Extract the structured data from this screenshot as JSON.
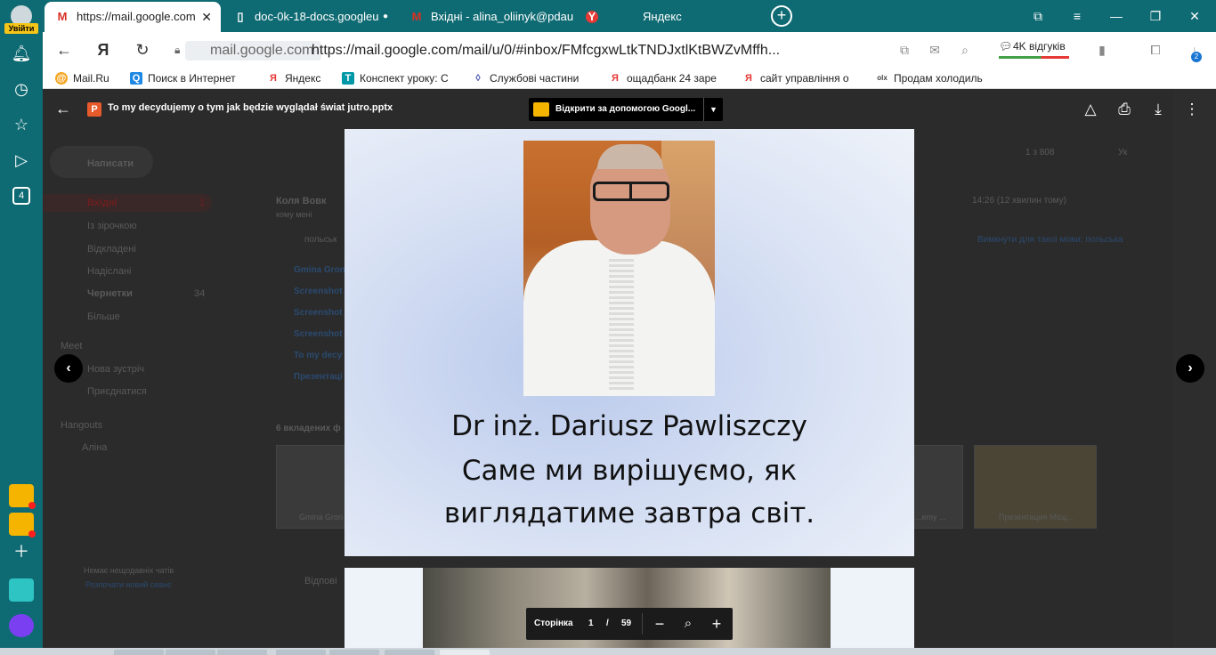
{
  "sidebar": {
    "login_label": "Увійти",
    "tab_count": "4"
  },
  "tabs": [
    {
      "label": "https://mail.google.com",
      "icon": "M",
      "color": "#d93025"
    },
    {
      "label": "doc-0k-18-docs.googleu",
      "icon": "▯",
      "color": "#ffffff"
    },
    {
      "label": "Вхідні - alina_oliinyk@pdau",
      "icon": "M",
      "color": "#d93025"
    },
    {
      "label": "Яндекс",
      "icon": "Y",
      "color": "#ffffff"
    }
  ],
  "address": {
    "domain": "mail.google.com",
    "url": "https://mail.google.com/mail/u/0/#inbox/FMfcgxwLtkTNDJxtlKtBWZvMffh...",
    "reviews_label": "4K відгуків",
    "downloads_count": "2"
  },
  "bookmarks": [
    {
      "label": "Mail.Ru",
      "icon": "@",
      "color": "#f5a623"
    },
    {
      "label": "Поиск в Интернет",
      "icon": "Q",
      "color": "#1e88e5"
    },
    {
      "label": "Яндекс",
      "icon": "Я",
      "color": "#e53935"
    },
    {
      "label": "Конспект уроку: С",
      "icon": "T",
      "color": "#0097a7"
    },
    {
      "label": "Службові частини",
      "icon": "◊",
      "color": "#3949ab"
    },
    {
      "label": "ощадбанк 24 заре",
      "icon": "Я",
      "color": "#e53935"
    },
    {
      "label": "сайт управління о",
      "icon": "Я",
      "color": "#e53935"
    },
    {
      "label": "Продам холодиль",
      "icon": "olx",
      "color": "#3f3f3f"
    }
  ],
  "gmail": {
    "compose": "Написати",
    "nav": [
      {
        "label": "Вхідні",
        "count": "1"
      },
      {
        "label": "Із зірочкою",
        "count": ""
      },
      {
        "label": "Відкладені",
        "count": ""
      },
      {
        "label": "Надіслані",
        "count": ""
      },
      {
        "label": "Чернетки",
        "count": "34"
      },
      {
        "label": "Більше",
        "count": ""
      }
    ],
    "meet_title": "Meet",
    "meet_items": [
      "Нова зустріч",
      "Приєднатися"
    ],
    "hangouts_title": "Hangouts",
    "hangouts_user": "Аліна",
    "no_chats": "Немає нещодавніх чатів",
    "new_chat": "Розпочати новий сеанс",
    "sender": "Коля Вовк",
    "to_me": "кому мені",
    "time": "14:26 (12 хвилин тому)",
    "lang": "польськ",
    "disable_lang": "Вимкнути для такої мови: польська",
    "pagination": "1 з 808",
    "input_lang": "Ук",
    "attachments": [
      "Gmina Gron",
      "Screenshot",
      "Screenshot",
      "Screenshot",
      "To my decy",
      "Презентаці"
    ],
    "attachments_count": "6 вкладених ф",
    "thumb_labels": [
      "Gmina Gron",
      "...emy ...",
      "Презентация Місц..."
    ],
    "reply": "Відпові"
  },
  "viewer": {
    "title": "To my decydujemy o tym jak będzie wyglądał świat jutro.pptx",
    "open_with": "Відкрити за допомогою Googl...",
    "page_label": "Сторінка",
    "page_current": "1",
    "page_separator": "/",
    "page_total": "59"
  },
  "slide": {
    "line1": "Dr inż. Dariusz Pawliszczy",
    "line2": "Саме ми вирішуємо, як",
    "line3": "виглядатиме завтра світ."
  }
}
